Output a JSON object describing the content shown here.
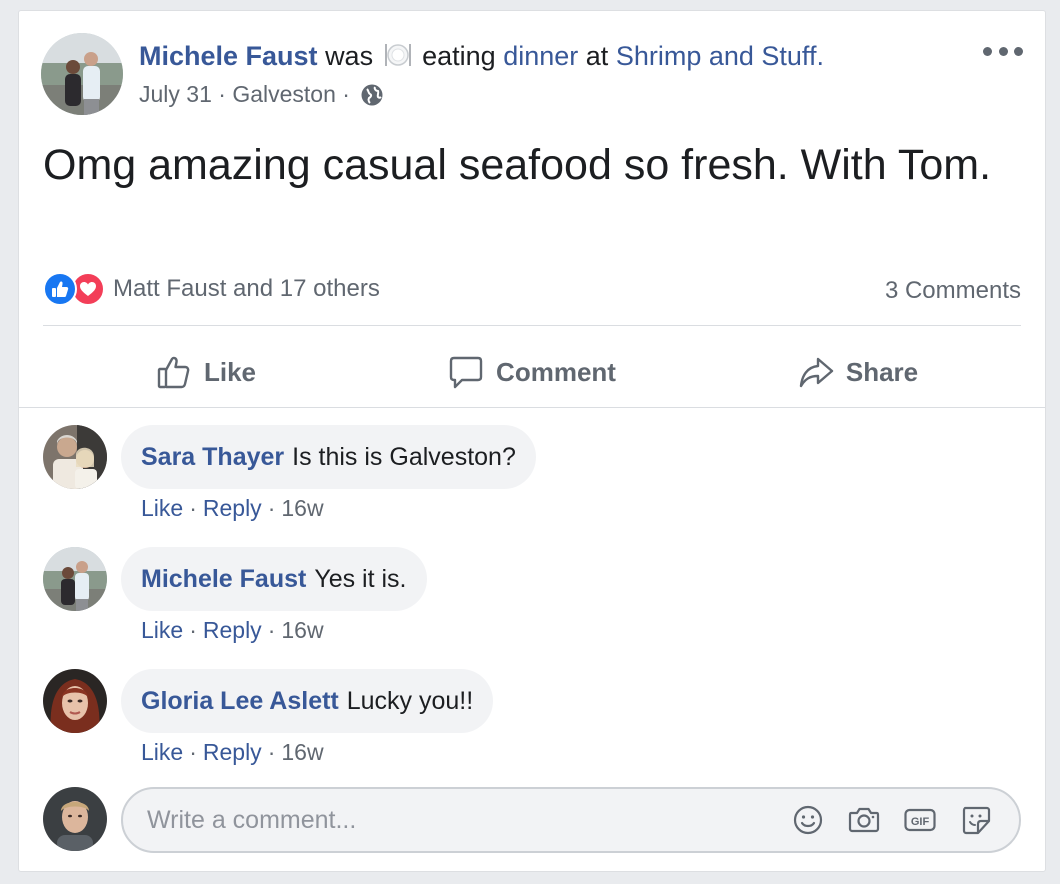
{
  "post": {
    "author": "Michele Faust",
    "was": "was",
    "activity_icon": "plate-icon",
    "activity": "eating",
    "activity_object": "dinner",
    "at": "at",
    "place": "Shrimp and Stuff",
    "period": ".",
    "date": "July 31",
    "dot1": "·",
    "location": "Galveston",
    "dot2": "·",
    "privacy_icon": "globe-icon",
    "text": "Omg amazing casual seafood so fresh. With Tom."
  },
  "reactions": {
    "icons": [
      "like-reaction-icon",
      "love-reaction-icon"
    ],
    "summary": "Matt Faust and 17 others",
    "comments_count": "3 Comments"
  },
  "actions": {
    "like": "Like",
    "comment": "Comment",
    "share": "Share"
  },
  "comments": [
    {
      "author": "Sara Thayer",
      "text": "Is this is Galveston?",
      "like": "Like",
      "reply": "Reply",
      "time": "16w"
    },
    {
      "author": "Michele Faust",
      "text": "Yes it is.",
      "like": "Like",
      "reply": "Reply",
      "time": "16w"
    },
    {
      "author": "Gloria Lee Aslett",
      "text": "Lucky you!!",
      "like": "Like",
      "reply": "Reply",
      "time": "16w"
    }
  ],
  "separator": "·",
  "composer": {
    "placeholder": "Write a comment...",
    "tools": [
      "emoji-icon",
      "camera-icon",
      "gif-icon",
      "sticker-icon"
    ]
  },
  "colors": {
    "link": "#385898",
    "muted": "#606770",
    "like_blue": "#1877f2",
    "love_red": "#f33e58",
    "bubble_bg": "#f2f3f5"
  }
}
